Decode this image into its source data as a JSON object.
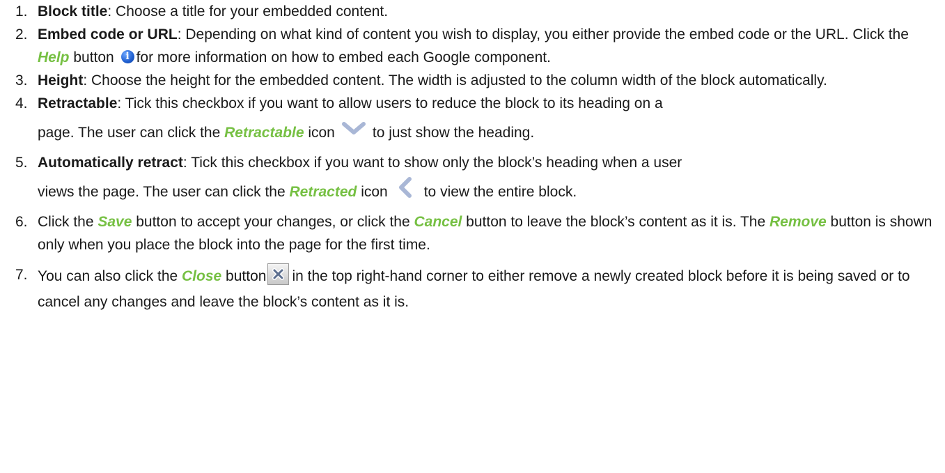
{
  "steps": [
    {
      "num": "1.",
      "label": "Block title",
      "text": ": Choose a title for your embedded content."
    },
    {
      "num": "2.",
      "label": "Embed code or URL",
      "text_a": ": Depending on what kind of content you wish to display, you either provide the embed code or the URL. Click the ",
      "ui": "Help",
      "text_b": " button ",
      "text_c": "for more information on how to embed each Google component.",
      "icon": "info-icon"
    },
    {
      "num": "3.",
      "label": "Height",
      "text": ": Choose the height for the embedded content. The width is adjusted to the column width of the block automatically."
    },
    {
      "num": "4.",
      "label": "Retractable",
      "text_a": ": Tick this checkbox if you want to allow users to reduce the block to its heading on a",
      "text_b": "page. The user can click the ",
      "ui": "Retractable",
      "text_c": " icon",
      "text_d": "to just show the heading.",
      "icon": "chevron-down-icon"
    },
    {
      "num": "5.",
      "label": "Automatically retract",
      "text_a": ": Tick this checkbox if you want to show only the block’s heading when a user",
      "text_b": "views the page. The user can click the ",
      "ui": "Retracted",
      "text_c": " icon",
      "text_d": "to view the entire block.",
      "icon": "chevron-left-icon"
    },
    {
      "num": "6.",
      "text_a": "Click the ",
      "ui_a": "Save",
      "text_b": " button to accept your changes, or click the ",
      "ui_b": "Cancel",
      "text_c": " button to leave the block’s content as it is. The ",
      "ui_c": "Remove",
      "text_d": " button is shown only when you place the block into the page for the first time."
    },
    {
      "num": "7.",
      "text_a": "You can also click the ",
      "ui": "Close",
      "text_b": " button",
      "text_c": "in the top right-hand corner to either remove a newly created block before it is being saved or to cancel any changes and leave the block’s content as it is.",
      "icon": "close-icon"
    }
  ],
  "colors": {
    "ui_highlight": "#76c043",
    "text": "#1a1a1a",
    "info_icon": "#1f5fd0",
    "chevron": "#a9b7d6"
  }
}
